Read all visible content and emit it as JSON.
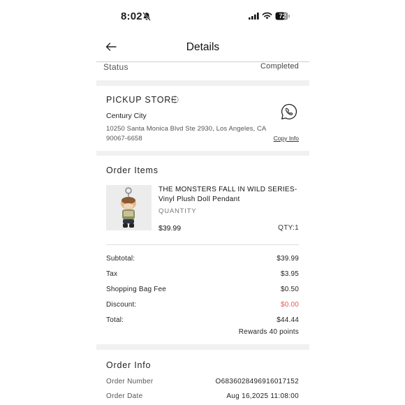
{
  "status_bar": {
    "time": "8:02",
    "battery": "72"
  },
  "nav": {
    "title": "Details"
  },
  "status": {
    "label": "Status",
    "value": "Completed"
  },
  "pickup": {
    "title": "PICKUP STORE",
    "store_name": "Century City",
    "address": "10250 Santa Monica Blvd Ste 2930, Los Angeles, CA 90067-6658",
    "copy_label": "Copy Info"
  },
  "order_items": {
    "title": "Order Items",
    "product": {
      "name": "THE MONSTERS FALL IN WILD SERIES-Vinyl Plush Doll Pendant",
      "quantity_label": "QUANTITY",
      "price": "$39.99",
      "qty": "QTY:1"
    },
    "summary": [
      {
        "label": "Subtotal:",
        "value": "$39.99"
      },
      {
        "label": "Tax",
        "value": "$3.95"
      },
      {
        "label": "Shopping Bag Fee",
        "value": "$0.50"
      },
      {
        "label": "Discount:",
        "value": "$0.00"
      },
      {
        "label": "Total:",
        "value": "$44.44"
      }
    ],
    "rewards": "Rewards 40 points"
  },
  "order_info": {
    "title": "Order Info",
    "rows": [
      {
        "label": "Order Number",
        "value": "O6836028496916017152"
      },
      {
        "label": "Order Date",
        "value": "Aug 16,2025 11:08:00"
      }
    ]
  },
  "colors": {
    "discount": "#e15a5a",
    "page_bg": "#f1f1f1"
  }
}
